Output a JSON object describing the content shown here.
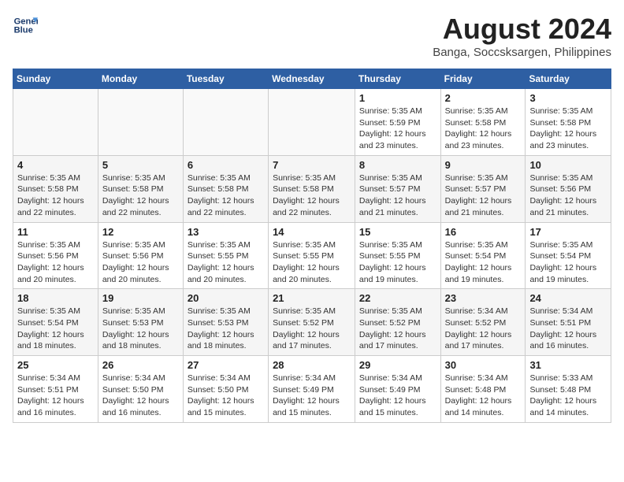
{
  "header": {
    "logo_line1": "General",
    "logo_line2": "Blue",
    "month_year": "August 2024",
    "location": "Banga, Soccsksargen, Philippines"
  },
  "weekdays": [
    "Sunday",
    "Monday",
    "Tuesday",
    "Wednesday",
    "Thursday",
    "Friday",
    "Saturday"
  ],
  "weeks": [
    [
      {
        "day": "",
        "detail": ""
      },
      {
        "day": "",
        "detail": ""
      },
      {
        "day": "",
        "detail": ""
      },
      {
        "day": "",
        "detail": ""
      },
      {
        "day": "1",
        "detail": "Sunrise: 5:35 AM\nSunset: 5:59 PM\nDaylight: 12 hours\nand 23 minutes."
      },
      {
        "day": "2",
        "detail": "Sunrise: 5:35 AM\nSunset: 5:58 PM\nDaylight: 12 hours\nand 23 minutes."
      },
      {
        "day": "3",
        "detail": "Sunrise: 5:35 AM\nSunset: 5:58 PM\nDaylight: 12 hours\nand 23 minutes."
      }
    ],
    [
      {
        "day": "4",
        "detail": "Sunrise: 5:35 AM\nSunset: 5:58 PM\nDaylight: 12 hours\nand 22 minutes."
      },
      {
        "day": "5",
        "detail": "Sunrise: 5:35 AM\nSunset: 5:58 PM\nDaylight: 12 hours\nand 22 minutes."
      },
      {
        "day": "6",
        "detail": "Sunrise: 5:35 AM\nSunset: 5:58 PM\nDaylight: 12 hours\nand 22 minutes."
      },
      {
        "day": "7",
        "detail": "Sunrise: 5:35 AM\nSunset: 5:58 PM\nDaylight: 12 hours\nand 22 minutes."
      },
      {
        "day": "8",
        "detail": "Sunrise: 5:35 AM\nSunset: 5:57 PM\nDaylight: 12 hours\nand 21 minutes."
      },
      {
        "day": "9",
        "detail": "Sunrise: 5:35 AM\nSunset: 5:57 PM\nDaylight: 12 hours\nand 21 minutes."
      },
      {
        "day": "10",
        "detail": "Sunrise: 5:35 AM\nSunset: 5:56 PM\nDaylight: 12 hours\nand 21 minutes."
      }
    ],
    [
      {
        "day": "11",
        "detail": "Sunrise: 5:35 AM\nSunset: 5:56 PM\nDaylight: 12 hours\nand 20 minutes."
      },
      {
        "day": "12",
        "detail": "Sunrise: 5:35 AM\nSunset: 5:56 PM\nDaylight: 12 hours\nand 20 minutes."
      },
      {
        "day": "13",
        "detail": "Sunrise: 5:35 AM\nSunset: 5:55 PM\nDaylight: 12 hours\nand 20 minutes."
      },
      {
        "day": "14",
        "detail": "Sunrise: 5:35 AM\nSunset: 5:55 PM\nDaylight: 12 hours\nand 20 minutes."
      },
      {
        "day": "15",
        "detail": "Sunrise: 5:35 AM\nSunset: 5:55 PM\nDaylight: 12 hours\nand 19 minutes."
      },
      {
        "day": "16",
        "detail": "Sunrise: 5:35 AM\nSunset: 5:54 PM\nDaylight: 12 hours\nand 19 minutes."
      },
      {
        "day": "17",
        "detail": "Sunrise: 5:35 AM\nSunset: 5:54 PM\nDaylight: 12 hours\nand 19 minutes."
      }
    ],
    [
      {
        "day": "18",
        "detail": "Sunrise: 5:35 AM\nSunset: 5:54 PM\nDaylight: 12 hours\nand 18 minutes."
      },
      {
        "day": "19",
        "detail": "Sunrise: 5:35 AM\nSunset: 5:53 PM\nDaylight: 12 hours\nand 18 minutes."
      },
      {
        "day": "20",
        "detail": "Sunrise: 5:35 AM\nSunset: 5:53 PM\nDaylight: 12 hours\nand 18 minutes."
      },
      {
        "day": "21",
        "detail": "Sunrise: 5:35 AM\nSunset: 5:52 PM\nDaylight: 12 hours\nand 17 minutes."
      },
      {
        "day": "22",
        "detail": "Sunrise: 5:35 AM\nSunset: 5:52 PM\nDaylight: 12 hours\nand 17 minutes."
      },
      {
        "day": "23",
        "detail": "Sunrise: 5:34 AM\nSunset: 5:52 PM\nDaylight: 12 hours\nand 17 minutes."
      },
      {
        "day": "24",
        "detail": "Sunrise: 5:34 AM\nSunset: 5:51 PM\nDaylight: 12 hours\nand 16 minutes."
      }
    ],
    [
      {
        "day": "25",
        "detail": "Sunrise: 5:34 AM\nSunset: 5:51 PM\nDaylight: 12 hours\nand 16 minutes."
      },
      {
        "day": "26",
        "detail": "Sunrise: 5:34 AM\nSunset: 5:50 PM\nDaylight: 12 hours\nand 16 minutes."
      },
      {
        "day": "27",
        "detail": "Sunrise: 5:34 AM\nSunset: 5:50 PM\nDaylight: 12 hours\nand 15 minutes."
      },
      {
        "day": "28",
        "detail": "Sunrise: 5:34 AM\nSunset: 5:49 PM\nDaylight: 12 hours\nand 15 minutes."
      },
      {
        "day": "29",
        "detail": "Sunrise: 5:34 AM\nSunset: 5:49 PM\nDaylight: 12 hours\nand 15 minutes."
      },
      {
        "day": "30",
        "detail": "Sunrise: 5:34 AM\nSunset: 5:48 PM\nDaylight: 12 hours\nand 14 minutes."
      },
      {
        "day": "31",
        "detail": "Sunrise: 5:33 AM\nSunset: 5:48 PM\nDaylight: 12 hours\nand 14 minutes."
      }
    ]
  ]
}
